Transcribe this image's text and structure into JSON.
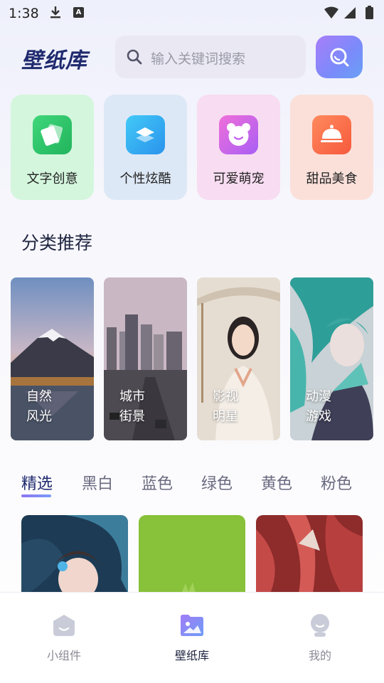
{
  "status_bar": {
    "time": "1:38",
    "a_badge": "A"
  },
  "header": {
    "title": "壁纸库",
    "search_placeholder": "输入关键词搜索"
  },
  "quick_categories": [
    {
      "label": "文字创意",
      "bg": "#d5f5dc",
      "icon_color": "#2bc46a",
      "icon": "cards-icon"
    },
    {
      "label": "个性炫酷",
      "bg": "#dde8f6",
      "icon_color": "#2aa9ef",
      "icon": "layers-icon"
    },
    {
      "label": "可爱萌宠",
      "bg": "#f7dcef",
      "icon_color": "#c35ef2",
      "icon": "bear-face-icon"
    },
    {
      "label": "甜品美食",
      "bg": "#fbe1da",
      "icon_color": "#fb6b4a",
      "icon": "cloche-icon"
    }
  ],
  "section_title": "分类推荐",
  "recommend_categories": [
    {
      "line1": "自然",
      "line2": "风光"
    },
    {
      "line1": "城市",
      "line2": "街景"
    },
    {
      "line1": "影视",
      "line2": "明星"
    },
    {
      "line1": "动漫",
      "line2": "游戏"
    }
  ],
  "tabs": [
    "精选",
    "黑白",
    "蓝色",
    "绿色",
    "黄色",
    "粉色"
  ],
  "active_tab": "精选",
  "bottom_nav": [
    {
      "label": "小组件",
      "icon": "widget-icon",
      "active": false
    },
    {
      "label": "壁纸库",
      "icon": "image-gallery-icon",
      "active": true
    },
    {
      "label": "我的",
      "icon": "profile-icon",
      "active": false
    }
  ],
  "colors": {
    "accent": "#1f2a6e",
    "gradient_start": "#a87ef9",
    "gradient_end": "#68a1f5"
  }
}
